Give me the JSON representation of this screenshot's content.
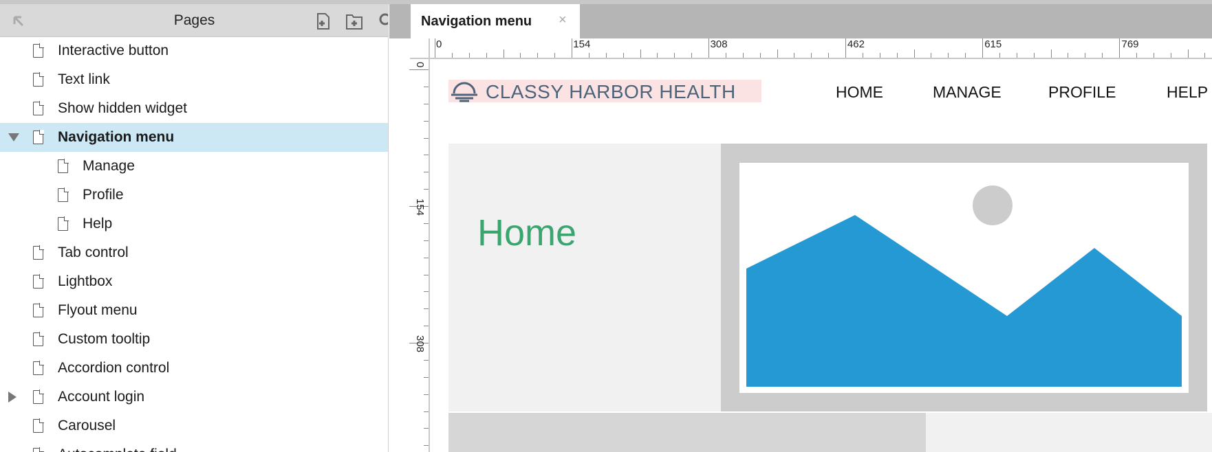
{
  "sidebar": {
    "title": "Pages",
    "items": [
      {
        "label": "Interactive button",
        "level": 0
      },
      {
        "label": "Text link",
        "level": 0
      },
      {
        "label": "Show hidden widget",
        "level": 0
      },
      {
        "label": "Navigation menu",
        "level": 0,
        "selected": true,
        "expanded": true
      },
      {
        "label": "Manage",
        "level": 1
      },
      {
        "label": "Profile",
        "level": 1
      },
      {
        "label": "Help",
        "level": 1
      },
      {
        "label": "Tab control",
        "level": 0
      },
      {
        "label": "Lightbox",
        "level": 0
      },
      {
        "label": "Flyout menu",
        "level": 0
      },
      {
        "label": "Custom tooltip",
        "level": 0
      },
      {
        "label": "Accordion control",
        "level": 0
      },
      {
        "label": "Account login",
        "level": 0,
        "collapsed": true
      },
      {
        "label": "Carousel",
        "level": 0
      },
      {
        "label": "Autocomplete field",
        "level": 0
      }
    ]
  },
  "tab": {
    "label": "Navigation menu",
    "close": "×"
  },
  "ruler": {
    "h": [
      "0",
      "154",
      "308",
      "462",
      "615",
      "769"
    ],
    "v": [
      "0",
      "154",
      "308"
    ]
  },
  "page": {
    "logo": "CLASSY HARBOR HEALTH",
    "nav": [
      "HOME",
      "MANAGE",
      "PROFILE",
      "HELP"
    ],
    "hero_title": "Home"
  },
  "colors": {
    "accent_green": "#3aa56e",
    "mountain_blue": "#2599d4",
    "selection": "#cde8f5",
    "logo_text": "#4d6379"
  }
}
